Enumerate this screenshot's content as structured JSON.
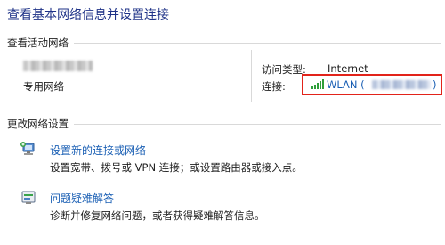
{
  "header": {
    "title": "查看基本网络信息并设置连接"
  },
  "active_networks": {
    "section_label": "查看活动网络",
    "network_type": "专用网络",
    "access_type_label": "访问类型:",
    "access_type_value": "Internet",
    "connections_label": "连接:",
    "connection_link": "WLAN (",
    "connection_link_close": ")"
  },
  "change_settings": {
    "section_label": "更改网络设置",
    "tasks": [
      {
        "icon": "network-setup-icon",
        "link": "设置新的连接或网络",
        "description": "设置宽带、拨号或 VPN 连接；或设置路由器或接入点。"
      },
      {
        "icon": "troubleshoot-icon",
        "link": "问题疑难解答",
        "description": "诊断并修复网络问题，或者获得疑难解答信息。"
      }
    ]
  },
  "colors": {
    "link": "#1a5fb4",
    "title": "#1e3287",
    "highlight_border": "#e2231a",
    "signal": "#2e9e3a"
  }
}
